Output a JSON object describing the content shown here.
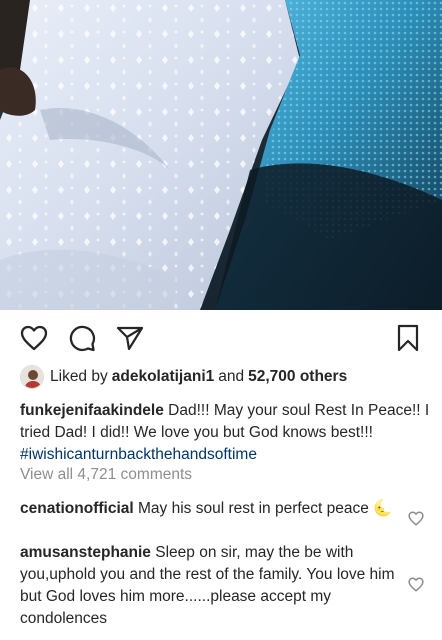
{
  "post": {
    "liked_by_prefix": "Liked by",
    "liked_by_user": "adekolatijani1",
    "liked_by_and": "and",
    "likes_others": "52,700 others",
    "caption_user": "funkejenifaakindele",
    "caption_text": "Dad!!! May your soul Rest In Peace!! I tried Dad! I did!! We love you but God knows best!!!",
    "caption_hashtag": "#iwishicanturnbackthehandsoftime",
    "view_all_comments": "View all 4,721 comments"
  },
  "comments": [
    {
      "user": "cenationofficial",
      "text": "May his soul rest in perfect peace 🌜"
    },
    {
      "user": "amusanstephanie",
      "text": "Sleep on sir, may the be with you,uphold you and the rest of the family. You love him but God loves him more......please accept my condolences"
    }
  ],
  "icons": {
    "like": "heart-outline-icon",
    "comment": "comment-bubble-icon",
    "share": "paper-plane-icon",
    "save": "bookmark-icon",
    "comment_like": "small-heart-icon"
  },
  "colors": {
    "text": "#262626",
    "muted": "#8e8e8e",
    "hashtag": "#003569",
    "photo_white_fabric": "#d8e0ef",
    "photo_blue_fabric": "#3aa0c8"
  }
}
